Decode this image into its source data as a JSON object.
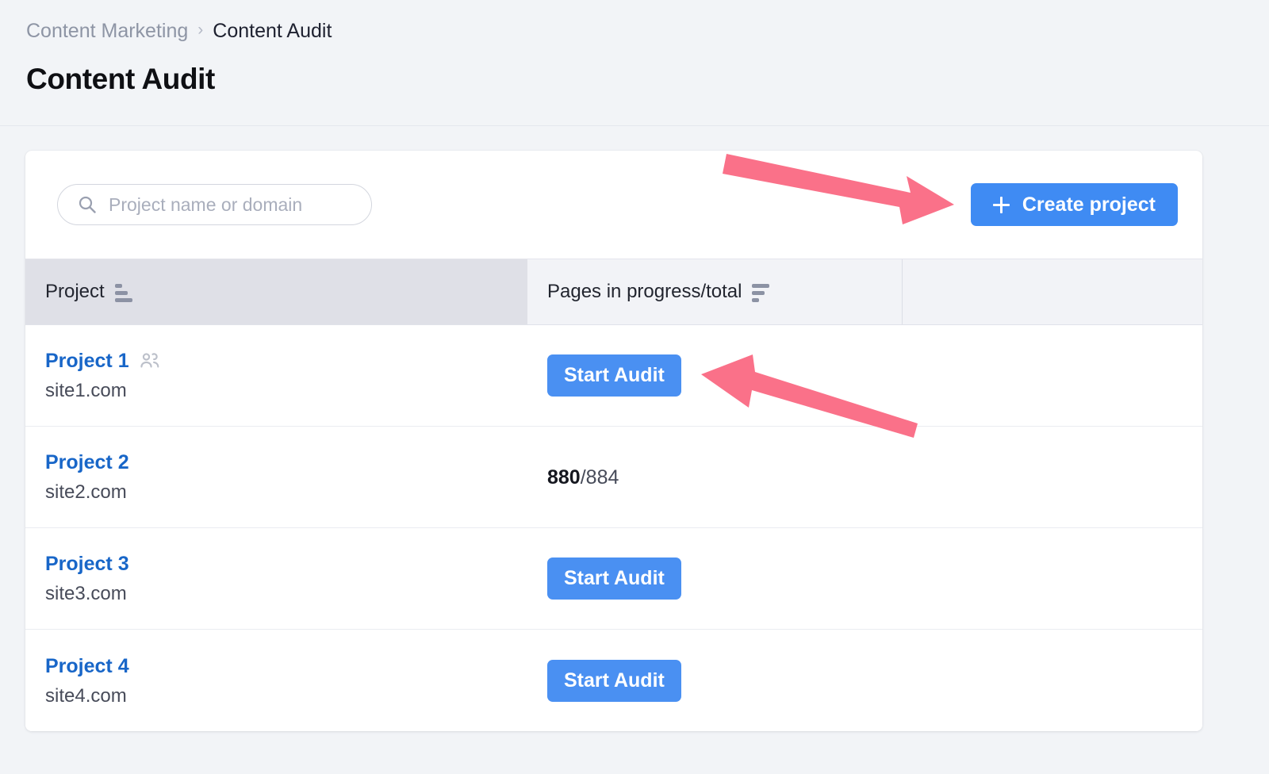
{
  "breadcrumb": {
    "parent": "Content Marketing",
    "separator": "›",
    "current": "Content Audit"
  },
  "header": {
    "title": "Content Audit"
  },
  "toolbar": {
    "search_placeholder": "Project name or domain",
    "search_value": "",
    "search_icon": "search-icon",
    "create_label": "Create project",
    "create_icon": "plus-icon"
  },
  "table": {
    "columns": [
      {
        "label": "Project",
        "sort_icon": "sort-ascending-icon",
        "sorted": true
      },
      {
        "label": "Pages in progress/total",
        "sort_icon": "sort-descending-icon",
        "sorted": false
      },
      {
        "label": "",
        "sort_icon": "",
        "sorted": false
      }
    ],
    "rows": [
      {
        "name": "Project 1",
        "domain": "site1.com",
        "shared": true,
        "shared_icon": "shared-users-icon",
        "action_label": "Start Audit",
        "pages_done": "",
        "pages_total": ""
      },
      {
        "name": "Project 2",
        "domain": "site2.com",
        "shared": false,
        "shared_icon": "",
        "action_label": "",
        "pages_done": "880",
        "pages_total": "/884"
      },
      {
        "name": "Project 3",
        "domain": "site3.com",
        "shared": false,
        "shared_icon": "",
        "action_label": "Start Audit",
        "pages_done": "",
        "pages_total": ""
      },
      {
        "name": "Project 4",
        "domain": "site4.com",
        "shared": false,
        "shared_icon": "",
        "action_label": "Start Audit",
        "pages_done": "",
        "pages_total": ""
      }
    ]
  },
  "annotations": {
    "color": "#fa7189",
    "arrows": [
      {
        "name": "arrow-to-create-project",
        "target": "create-project-button"
      },
      {
        "name": "arrow-to-start-audit",
        "target": "start-audit-button-row-1"
      }
    ]
  },
  "colors": {
    "accent_blue": "#3f8bf3",
    "link_blue": "#1866c8",
    "annotation_pink": "#fa7189",
    "page_background": "#f2f4f7",
    "header_cell_active": "#dfe0e7"
  }
}
